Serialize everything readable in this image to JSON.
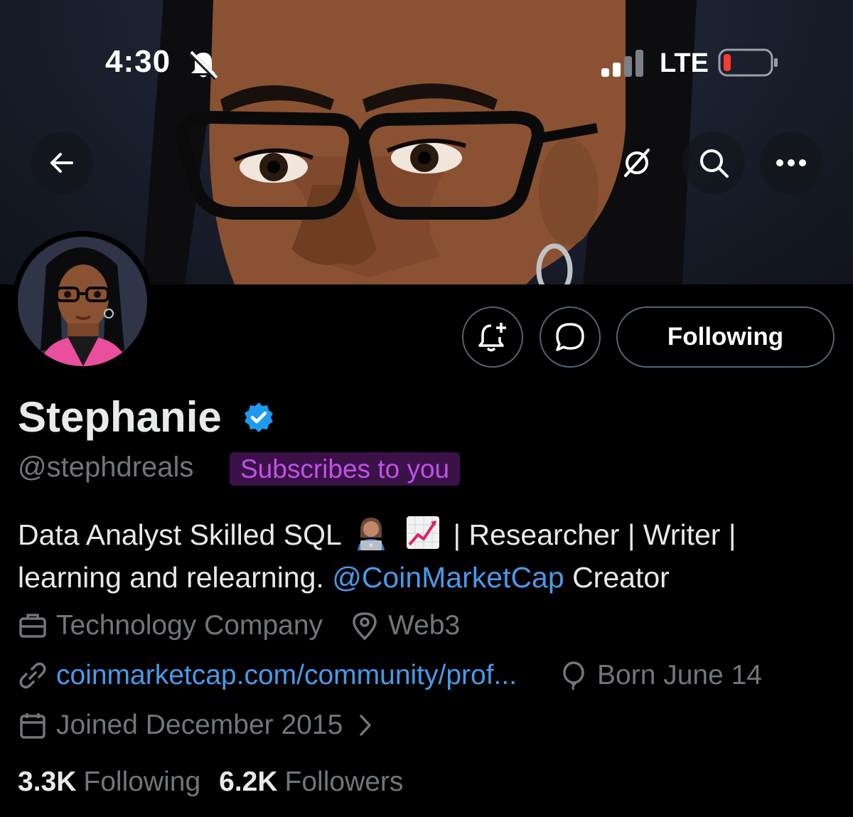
{
  "status_bar": {
    "time": "4:30",
    "network": "LTE"
  },
  "header": {
    "back_icon": "arrow-left-icon",
    "grok_icon": "grok-icon",
    "search_icon": "search-icon",
    "more_icon": "more-horizontal-icon"
  },
  "actions": {
    "notify_icon": "bell-plus-icon",
    "message_icon": "chat-bubble-icon",
    "following_label": "Following"
  },
  "profile": {
    "name": "Stephanie",
    "handle": "@stephdreals",
    "subscribes_badge": "Subscribes to you",
    "bio_part1": "Data Analyst Skilled SQL",
    "bio_part2": " | Researcher | Writer |",
    "bio_line2_start": "learning and relearning. ",
    "bio_mention": "@CoinMarketCap",
    "bio_end": " Creator",
    "bio_emojis": [
      "woman-technologist-emoji",
      "chart-increasing-emoji"
    ],
    "category": "Technology Company",
    "location": "Web3",
    "website": "coinmarketcap.com/community/prof...",
    "birthday": "Born June 14",
    "joined": "Joined December 2015"
  },
  "stats": {
    "following_count": "3.3K",
    "following_label": "Following",
    "followers_count": "6.2K",
    "followers_label": "Followers"
  },
  "colors": {
    "accent_link": "#4a99e9",
    "muted_text": "#71767b",
    "badge_bg": "#3b1247",
    "badge_text": "#c052e6",
    "verified": "#1d9bf0"
  }
}
